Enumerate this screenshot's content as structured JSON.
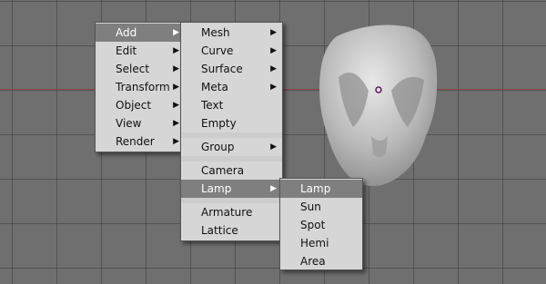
{
  "menus": {
    "main": {
      "items": [
        {
          "label": "Add",
          "arrow": "▶"
        },
        {
          "label": "Edit",
          "arrow": "▶"
        },
        {
          "label": "Select",
          "arrow": "▶"
        },
        {
          "label": "Transform",
          "arrow": "▶"
        },
        {
          "label": "Object",
          "arrow": "▶"
        },
        {
          "label": "View",
          "arrow": "▶"
        },
        {
          "label": "Render",
          "arrow": "▶"
        }
      ]
    },
    "add": {
      "items": [
        {
          "label": "Mesh",
          "arrow": "▶"
        },
        {
          "label": "Curve",
          "arrow": "▶"
        },
        {
          "label": "Surface",
          "arrow": "▶"
        },
        {
          "label": "Meta",
          "arrow": "▶"
        },
        {
          "label": "Text"
        },
        {
          "label": "Empty"
        },
        {
          "label": "Group",
          "arrow": "▶"
        },
        {
          "label": "Camera"
        },
        {
          "label": "Lamp",
          "arrow": "▶"
        },
        {
          "label": "Armature"
        },
        {
          "label": "Lattice"
        }
      ]
    },
    "lamp": {
      "items": [
        {
          "label": "Lamp"
        },
        {
          "label": "Sun"
        },
        {
          "label": "Spot"
        },
        {
          "label": "Hemi"
        },
        {
          "label": "Area"
        }
      ]
    }
  },
  "colors": {
    "viewport_bg": "#6f6f6f",
    "menu_bg": "#d6d6d6",
    "highlight": "#7f7f7f",
    "axis": "#8c4a4a"
  }
}
